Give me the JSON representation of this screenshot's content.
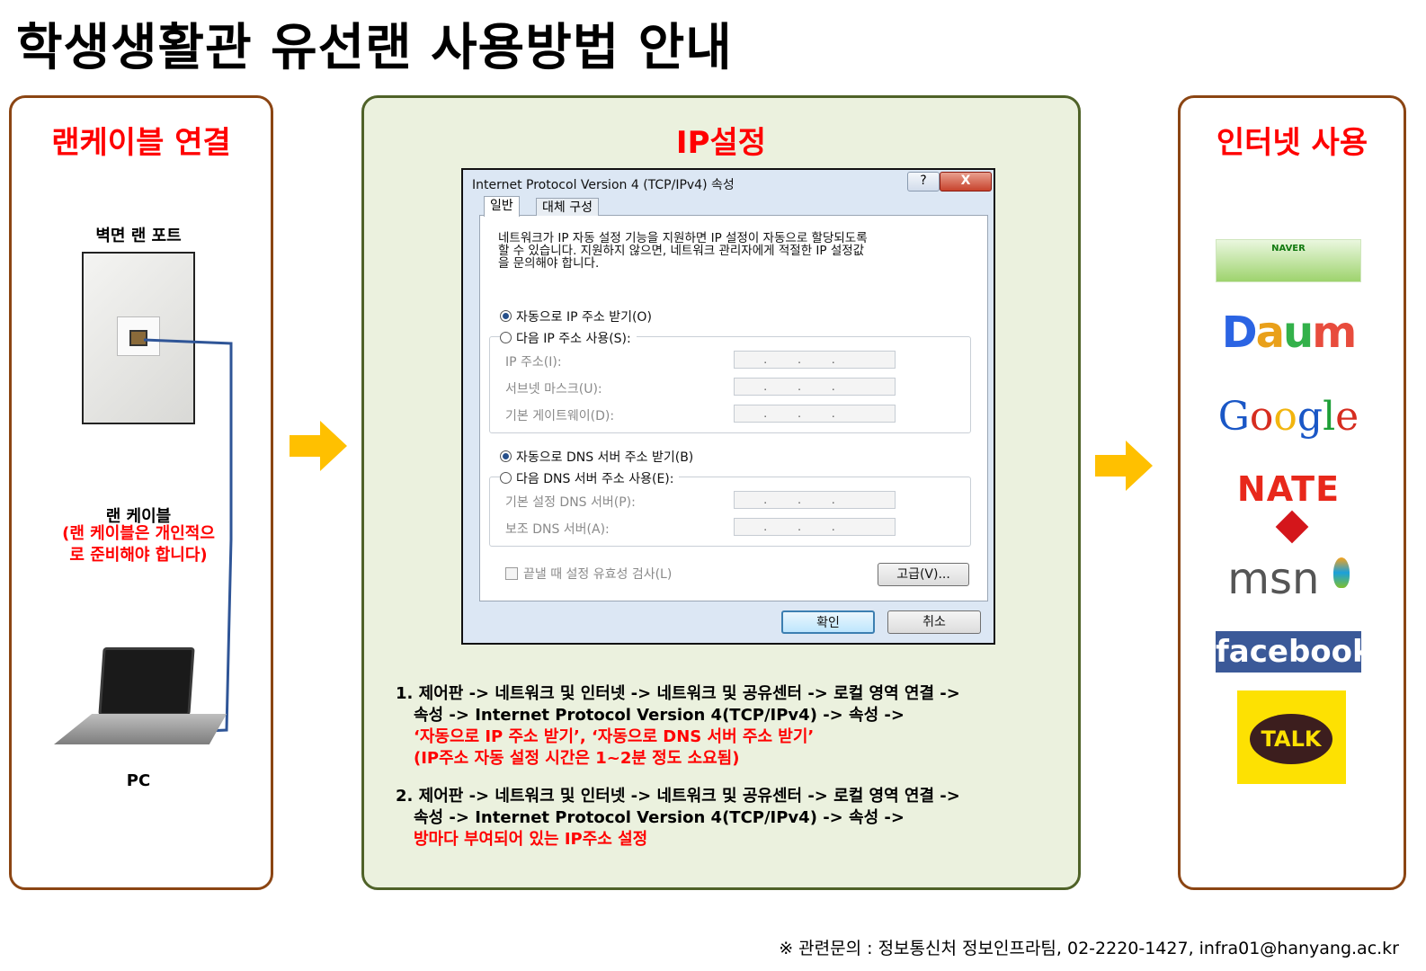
{
  "page_title": "학생생활관 유선랜 사용방법 안내",
  "left_panel": {
    "heading": "랜케이블 연결",
    "wall_port_label": "벽면 랜 포트",
    "cable_label": "랜 케이블",
    "cable_note_line1": "(랜 케이블은 개인적으",
    "cable_note_line2": "로 준비해야 합니다)",
    "pc_label": "PC"
  },
  "middle_panel": {
    "heading": "IP설정",
    "dialog": {
      "title": "Internet Protocol Version 4 (TCP/IPv4) 속성",
      "help_button": "?",
      "close_button": "X",
      "tab_general": "일반",
      "tab_alternate": "대체 구성",
      "description_line1": "네트워크가 IP 자동 설정 기능을 지원하면 IP 설정이 자동으로 할당되도록",
      "description_line2": "할 수 있습니다. 지원하지 않으면, 네트워크 관리자에게 적절한 IP 설정값",
      "description_line3": "을 문의해야 합니다.",
      "radio_auto_ip": "자동으로 IP 주소 받기(O)",
      "radio_manual_ip": "다음 IP 주소 사용(S):",
      "label_ip": "IP 주소(I):",
      "label_subnet": "서브넷 마스크(U):",
      "label_gateway": "기본 게이트웨이(D):",
      "radio_auto_dns": "자동으로 DNS 서버 주소 받기(B)",
      "radio_manual_dns": "다음 DNS 서버 주소 사용(E):",
      "label_dns_primary": "기본 설정 DNS 서버(P):",
      "label_dns_secondary": "보조 DNS 서버(A):",
      "ip_placeholder": "...",
      "checkbox_validate": "끝낼 때 설정 유효성 검사(L)",
      "advanced_button": "고급(V)...",
      "ok_button": "확인",
      "cancel_button": "취소"
    },
    "step1_line1": "1. 제어판 -> 네트워크 및 인터넷 -> 네트워크 및 공유센터 -> 로컬 영역 연결 ->",
    "step1_line2": "속성 -> Internet Protocol Version 4(TCP/IPv4) -> 속성 ->",
    "step1_line3": "‘자동으로 IP 주소 받기’, ‘자동으로 DNS 서버 주소 받기’",
    "step1_line4": "(IP주소 자동 설정 시간은 1~2분 정도 소요됨)",
    "step2_line1": "2. 제어판 -> 네트워크 및 인터넷 -> 네트워크 및 공유센터 -> 로컬 영역 연결 ->",
    "step2_line2": "속성 -> Internet Protocol Version 4(TCP/IPv4) -> 속성 ->",
    "step2_line3": "방마다 부여되어 있는 IP주소 설정"
  },
  "right_panel": {
    "heading": "인터넷 사용",
    "logos": {
      "naver": "NAVER",
      "daum": "Daum",
      "google": "Google",
      "nate": "NATE",
      "msn": "msn",
      "facebook": "facebook",
      "kakaotalk": "TALK"
    }
  },
  "footer": "※ 관련문의 : 정보통신처 정보인프라팀, 02-2220-1427, infra01@hanyang.ac.kr",
  "colors": {
    "heading_red": "#ff0000",
    "panel_border_brown": "#8b4513",
    "panel_mid_bg": "#ebf1de",
    "panel_mid_border": "#4f6228",
    "arrow_orange": "#ffc000",
    "cable_blue": "#2f5597"
  }
}
